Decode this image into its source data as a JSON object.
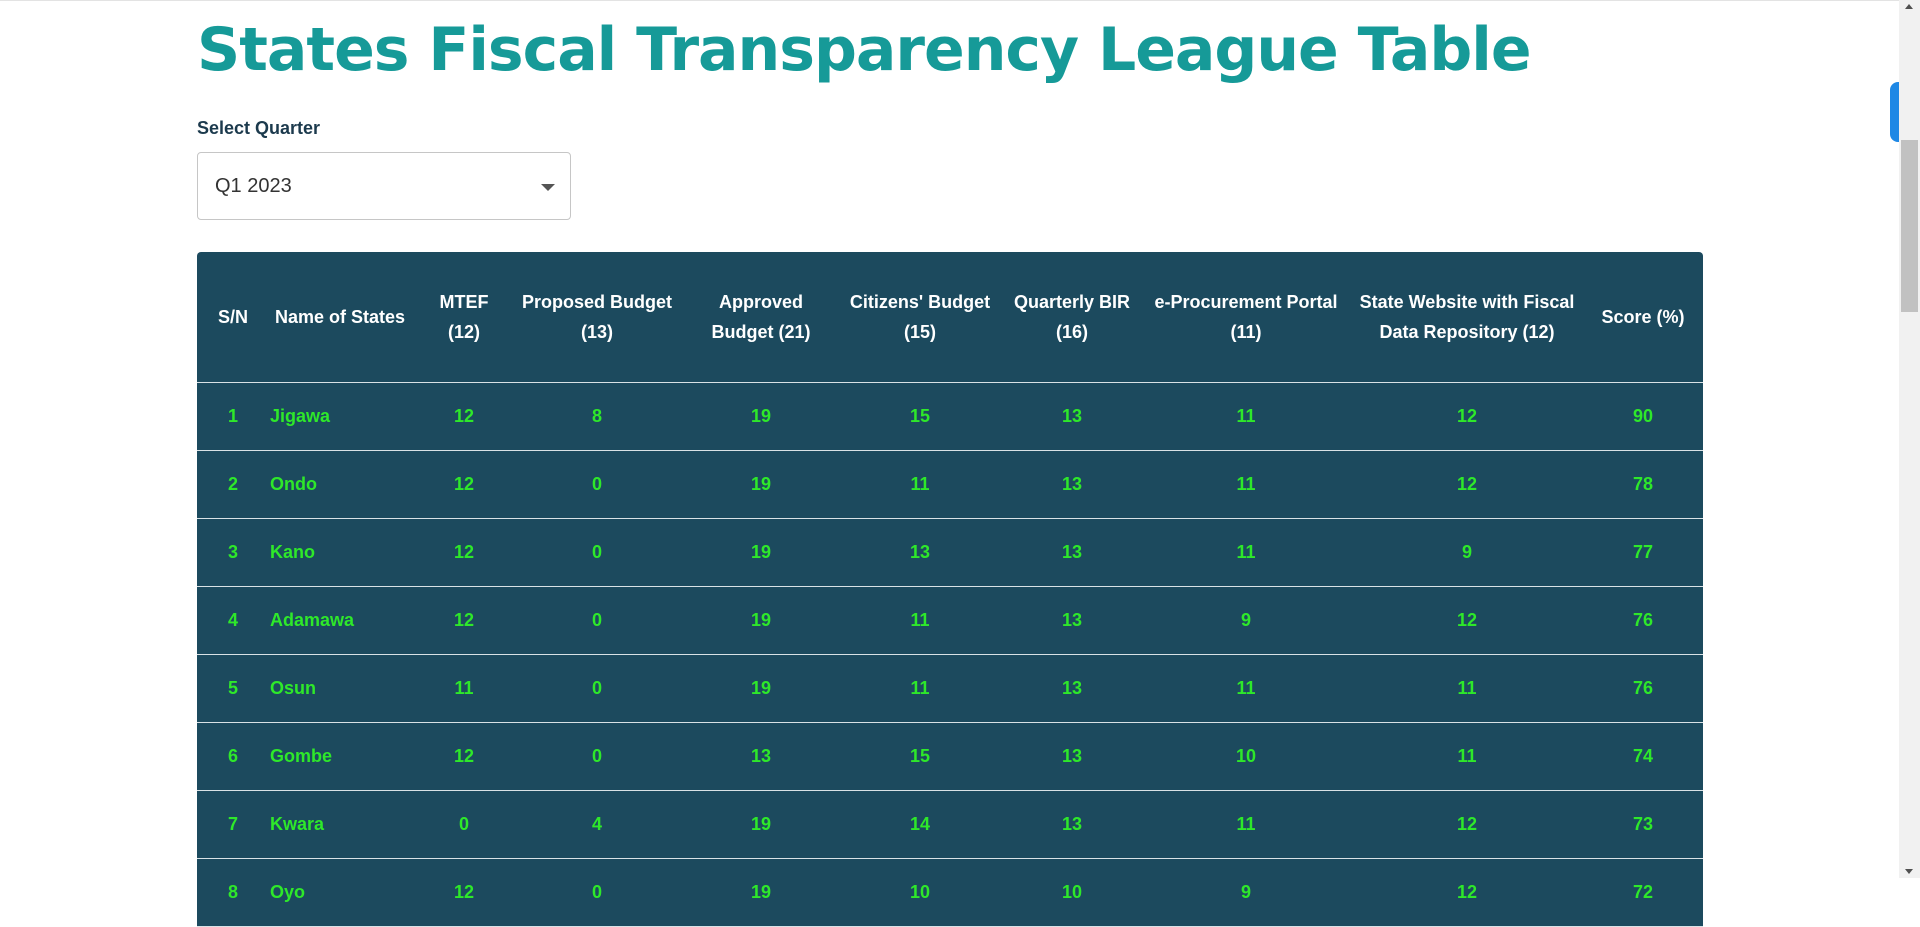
{
  "page": {
    "title": "States Fiscal Transparency League Table"
  },
  "filter": {
    "label": "Select Quarter",
    "selected": "Q1 2023"
  },
  "table": {
    "headers": [
      "S/N",
      "Name of States",
      "MTEF (12)",
      "Proposed Budget (13)",
      "Approved Budget (21)",
      "Citizens' Budget (15)",
      "Quarterly BIR (16)",
      "e-Procurement Portal (11)",
      "State Website with Fiscal Data Repository (12)",
      "Score (%)"
    ],
    "rows": [
      [
        "1",
        "Jigawa",
        "12",
        "8",
        "19",
        "15",
        "13",
        "11",
        "12",
        "90"
      ],
      [
        "2",
        "Ondo",
        "12",
        "0",
        "19",
        "11",
        "13",
        "11",
        "12",
        "78"
      ],
      [
        "3",
        "Kano",
        "12",
        "0",
        "19",
        "13",
        "13",
        "11",
        "9",
        "77"
      ],
      [
        "4",
        "Adamawa",
        "12",
        "0",
        "19",
        "11",
        "13",
        "9",
        "12",
        "76"
      ],
      [
        "5",
        "Osun",
        "11",
        "0",
        "19",
        "11",
        "13",
        "11",
        "11",
        "76"
      ],
      [
        "6",
        "Gombe",
        "12",
        "0",
        "13",
        "15",
        "13",
        "10",
        "11",
        "74"
      ],
      [
        "7",
        "Kwara",
        "0",
        "4",
        "19",
        "14",
        "13",
        "11",
        "12",
        "73"
      ],
      [
        "8",
        "Oyo",
        "12",
        "0",
        "19",
        "10",
        "10",
        "9",
        "12",
        "72"
      ]
    ]
  },
  "colors": {
    "title": "#169a98",
    "table_bg": "#1c4a5e",
    "cell_text": "#2ee82a",
    "header_text": "#ffffff",
    "side_tab": "#1e88e5"
  }
}
